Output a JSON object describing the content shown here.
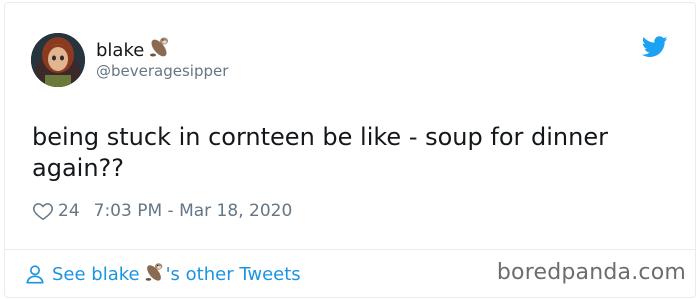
{
  "tweet": {
    "display_name": "blake",
    "name_emoji": "otter-emoji",
    "handle": "@beveragesipper",
    "text": "being stuck in cornteen be like - soup for dinner again??",
    "like_count": "24",
    "timestamp": "7:03 PM - Mar 18, 2020"
  },
  "footer": {
    "see_label": "See blake",
    "other_tweets_label": "'s other Tweets"
  },
  "watermark": "boredpanda.com",
  "icons": {
    "brand": "twitter-bird-icon",
    "like": "heart-outline-icon",
    "profile": "person-outline-icon"
  },
  "colors": {
    "link_blue": "#1b95e0",
    "twitter_blue": "#1da1f2",
    "muted_gray": "#657786",
    "text_dark": "#14171a"
  }
}
